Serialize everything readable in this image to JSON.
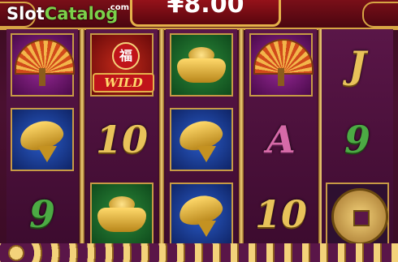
{
  "header": {
    "win_amount": "¥8.00",
    "logo_slot": "Slot",
    "logo_catalog": "Catalog",
    "logo_com": ".com"
  },
  "reels": [
    [
      {
        "symbol": "fan",
        "label": ""
      },
      {
        "symbol": "koi",
        "label": ""
      },
      {
        "symbol": "card",
        "label": "9",
        "color": "green"
      }
    ],
    [
      {
        "symbol": "wild",
        "label": "WILD",
        "glyph": "福"
      },
      {
        "symbol": "card",
        "label": "10",
        "color": "gold"
      },
      {
        "symbol": "ingot",
        "label": ""
      }
    ],
    [
      {
        "symbol": "ingot",
        "label": ""
      },
      {
        "symbol": "koi",
        "label": ""
      },
      {
        "symbol": "koi",
        "label": ""
      }
    ],
    [
      {
        "symbol": "fan",
        "label": ""
      },
      {
        "symbol": "card",
        "label": "A",
        "color": "pink"
      },
      {
        "symbol": "card",
        "label": "10",
        "color": "gold"
      }
    ],
    [
      {
        "symbol": "card",
        "label": "J",
        "color": "gold"
      },
      {
        "symbol": "card",
        "label": "9",
        "color": "green"
      },
      {
        "symbol": "coin",
        "label": ""
      }
    ]
  ],
  "colors": {
    "accent_gold": "#e5b24b",
    "reel_bg": "#4a1030",
    "wild_red": "#c0141a"
  }
}
